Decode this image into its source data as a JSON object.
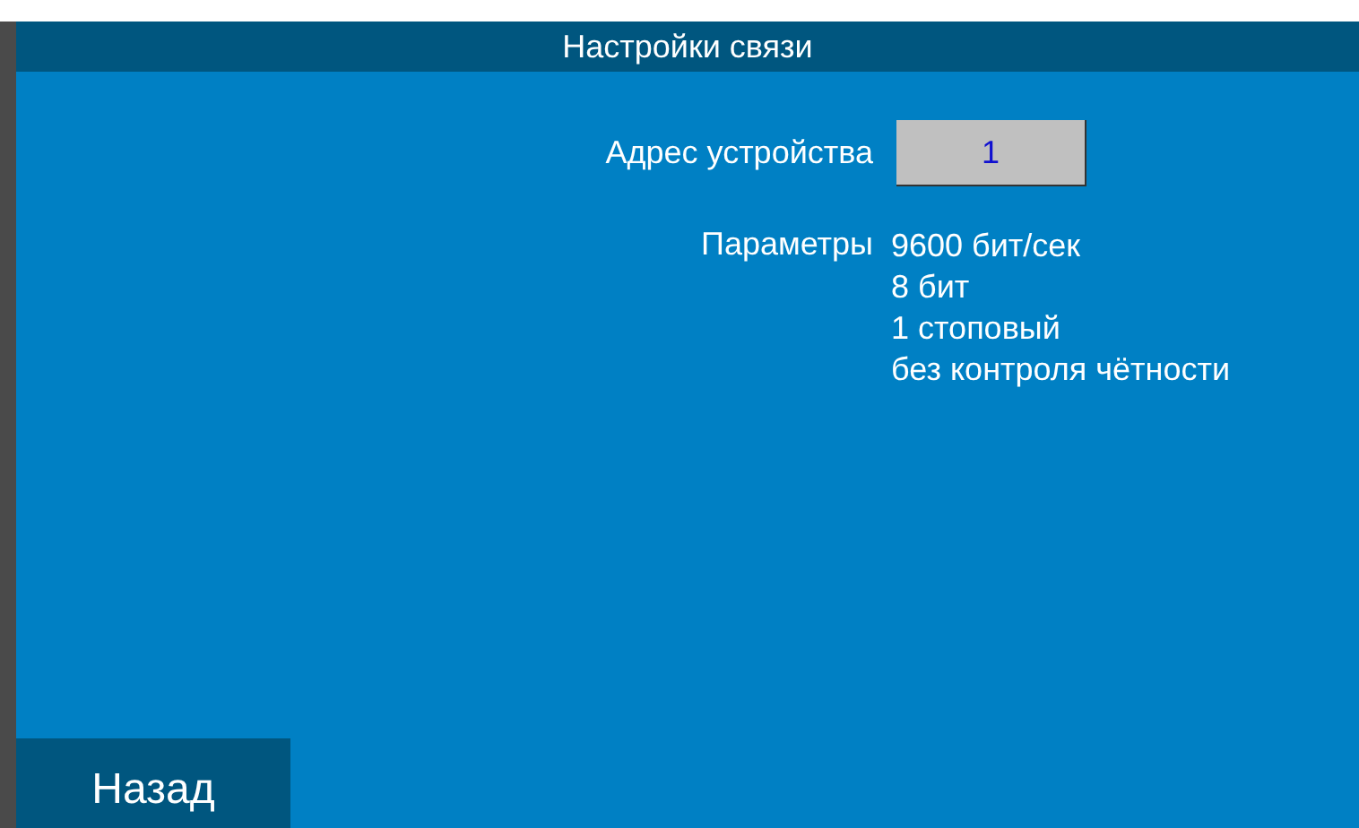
{
  "title": "Настройки связи",
  "address": {
    "label": "Адрес устройства",
    "value": "1"
  },
  "parameters": {
    "label": "Параметры",
    "values": [
      "9600 бит/сек",
      "8 бит",
      "1 стоповый",
      "без контроля чётности"
    ]
  },
  "back_button": "Назад"
}
